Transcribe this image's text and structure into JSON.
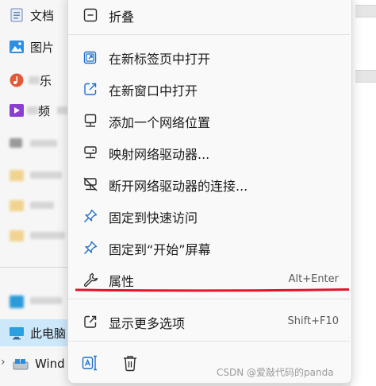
{
  "sidebar": {
    "items": [
      {
        "label": "文档",
        "icon": "document-icon"
      },
      {
        "label": "图片",
        "icon": "picture-icon"
      },
      {
        "label": "乐",
        "icon": "music-icon"
      },
      {
        "label": "频",
        "icon": "video-icon"
      },
      {
        "label": "此电脑",
        "icon": "pc-icon"
      },
      {
        "label": "Wind",
        "icon": "drive-icon"
      }
    ]
  },
  "menu": {
    "items": [
      {
        "label": "折叠",
        "icon": "collapse-icon",
        "shortcut": ""
      },
      {
        "label": "在新标签页中打开",
        "icon": "open-new-tab-icon",
        "shortcut": ""
      },
      {
        "label": "在新窗口中打开",
        "icon": "open-new-window-icon",
        "shortcut": ""
      },
      {
        "label": "添加一个网络位置",
        "icon": "network-location-icon",
        "shortcut": ""
      },
      {
        "label": "映射网络驱动器...",
        "icon": "map-network-drive-icon",
        "shortcut": ""
      },
      {
        "label": "断开网络驱动器的连接...",
        "icon": "disconnect-network-drive-icon",
        "shortcut": ""
      },
      {
        "label": "固定到快速访问",
        "icon": "pin-icon",
        "shortcut": ""
      },
      {
        "label": "固定到“开始”屏幕",
        "icon": "pin-start-icon",
        "shortcut": ""
      },
      {
        "label": "属性",
        "icon": "wrench-icon",
        "shortcut": "Alt+Enter"
      },
      {
        "label": "显示更多选项",
        "icon": "more-options-icon",
        "shortcut": "Shift+F10"
      }
    ]
  },
  "watermark": "CSDN @爱敲代码的panda",
  "colors": {
    "accent": "#1e6fc8",
    "selected_bg": "#cde8fb",
    "annotation_red": "#e0162b"
  }
}
